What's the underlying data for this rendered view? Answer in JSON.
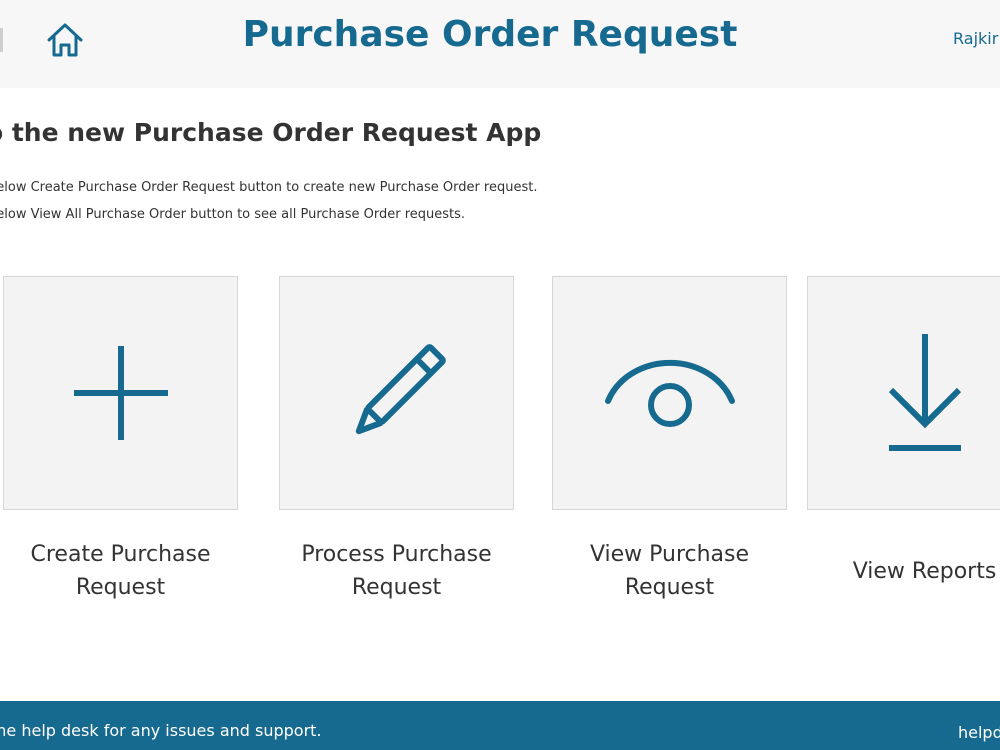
{
  "header": {
    "title": "Purchase Order Request",
    "user": "Rajkir",
    "home_icon": "home-icon"
  },
  "intro": {
    "welcome": "to the new Purchase Order Request App",
    "line1": "below Create Purchase Order Request button to create new Purchase Order request.",
    "line2": "below View All Purchase Order button to see all Purchase Order requests."
  },
  "tiles": [
    {
      "label": "Create Purchase Request",
      "icon": "plus-icon"
    },
    {
      "label": "Process Purchase Request",
      "icon": "pencil-icon"
    },
    {
      "label": "View Purchase Request",
      "icon": "eye-icon"
    },
    {
      "label": "View Reports",
      "icon": "download-icon"
    }
  ],
  "footer": {
    "text": "the help desk for any issues and support.",
    "link": "helpd"
  },
  "colors": {
    "accent": "#176a8f",
    "header_bg": "#f7f7f7",
    "tile_bg": "#f3f3f3"
  }
}
